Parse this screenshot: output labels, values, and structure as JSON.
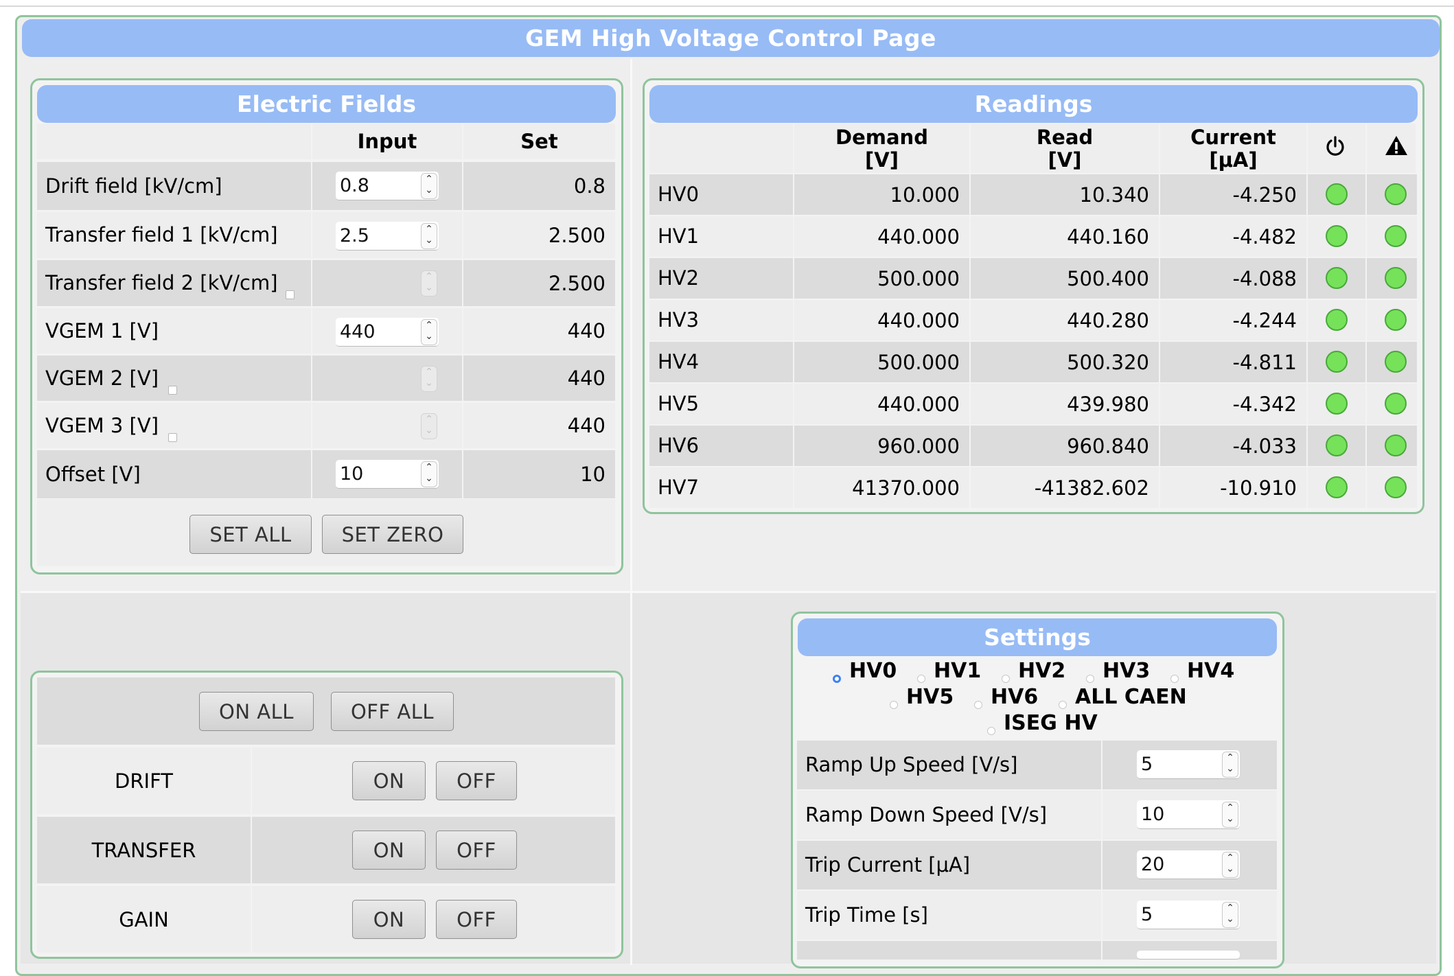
{
  "page": {
    "title": "GEM High Voltage Control Page"
  },
  "fields": {
    "title": "Electric Fields",
    "col_input": "Input",
    "col_set": "Set",
    "rows": [
      {
        "label": "Drift field [kV/cm]",
        "input": "0.8",
        "set": "0.8",
        "enabled": true
      },
      {
        "label": "Transfer field 1 [kV/cm]",
        "input": "2.5",
        "set": "2.500",
        "enabled": true
      },
      {
        "label": "Transfer field 2 [kV/cm]",
        "input": "",
        "set": "2.500",
        "enabled": false
      },
      {
        "label": "VGEM 1 [V]",
        "input": "440",
        "set": "440",
        "enabled": true
      },
      {
        "label": "VGEM 2 [V]",
        "input": "",
        "set": "440",
        "enabled": false
      },
      {
        "label": "VGEM 3 [V]",
        "input": "",
        "set": "440",
        "enabled": false
      },
      {
        "label": "Offset [V]",
        "input": "10",
        "set": "10",
        "enabled": true
      }
    ],
    "set_all": "SET ALL",
    "set_zero": "SET ZERO"
  },
  "readings": {
    "title": "Readings",
    "col_demand": "Demand",
    "col_demand_unit": "[V]",
    "col_read": "Read",
    "col_read_unit": "[V]",
    "col_current": "Current",
    "col_current_unit": "[μA]",
    "rows": [
      {
        "ch": "HV0",
        "demand": "10.000",
        "read": "10.340",
        "current": "-4.250"
      },
      {
        "ch": "HV1",
        "demand": "440.000",
        "read": "440.160",
        "current": "-4.482"
      },
      {
        "ch": "HV2",
        "demand": "500.000",
        "read": "500.400",
        "current": "-4.088"
      },
      {
        "ch": "HV3",
        "demand": "440.000",
        "read": "440.280",
        "current": "-4.244"
      },
      {
        "ch": "HV4",
        "demand": "500.000",
        "read": "500.320",
        "current": "-4.811"
      },
      {
        "ch": "HV5",
        "demand": "440.000",
        "read": "439.980",
        "current": "-4.342"
      },
      {
        "ch": "HV6",
        "demand": "960.000",
        "read": "960.840",
        "current": "-4.033"
      },
      {
        "ch": "HV7",
        "demand": "41370.000",
        "read": "-41382.602",
        "current": "-10.910"
      }
    ],
    "status_color": "#76e25a"
  },
  "switches": {
    "on_all": "ON ALL",
    "off_all": "OFF ALL",
    "rows": [
      {
        "label": "DRIFT",
        "on": "ON",
        "off": "OFF"
      },
      {
        "label": "TRANSFER",
        "on": "ON",
        "off": "OFF"
      },
      {
        "label": "GAIN",
        "on": "ON",
        "off": "OFF"
      }
    ]
  },
  "settings": {
    "title": "Settings",
    "channels": [
      "HV0",
      "HV1",
      "HV2",
      "HV3",
      "HV4",
      "HV5",
      "HV6",
      "ALL CAEN",
      "ISEG HV"
    ],
    "selected": "HV0",
    "rows": [
      {
        "label": "Ramp Up Speed [V/s]",
        "value": "5"
      },
      {
        "label": "Ramp Down Speed [V/s]",
        "value": "10"
      },
      {
        "label": "Trip Current [μA]",
        "value": "20"
      },
      {
        "label": "Trip Time [s]",
        "value": "5"
      }
    ]
  },
  "colors": {
    "title_bar": "#97bbf5",
    "panel_border": "#8fc49c",
    "led_on": "#76e25a"
  }
}
